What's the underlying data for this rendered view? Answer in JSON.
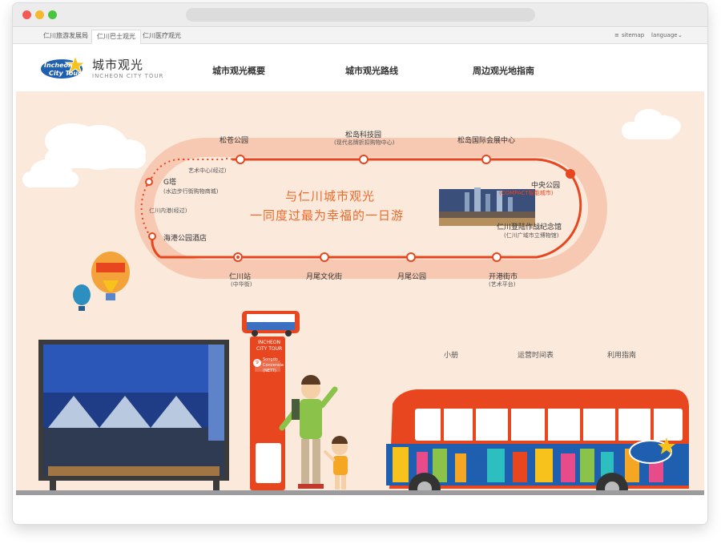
{
  "tabs": [
    "仁川旅游发展局",
    "仁川巴士观光",
    "仁川医疗观光"
  ],
  "util": {
    "sitemap": "sitemap",
    "language": "language"
  },
  "brand": {
    "title": "城市观光",
    "subtitle": "INCHEON CITY TOUR",
    "logo_text_1": "Incheon",
    "logo_text_2": "City Tour"
  },
  "nav": [
    "城市观光概要",
    "城市观光路线",
    "周边观光地指南"
  ],
  "route": {
    "top": [
      "松苍公园",
      "松岛科技园",
      "松岛国际会展中心"
    ],
    "top_sub": "(现代名牌折扣购物中心)",
    "right_1": "中央公园",
    "right_1_sub": "(COMPACT智能城市)",
    "right_2": "仁川登陆作战纪念馆",
    "right_2_sub": "(仁川广域市立博物馆)",
    "bottom": [
      "开港街市",
      "月尾公园",
      "月尾文化街",
      "仁川站"
    ],
    "bottom_sub_1": "(艺术平台)",
    "bottom_sub_2": "(中华街)",
    "left_g": "G塔",
    "left_g_sub": "(水边步行街购物商城)",
    "left_art": "艺术中心(经过)",
    "left_port": "仁川内港(经过)",
    "left_hotel": "海港公园酒店"
  },
  "slogan": {
    "line1": "与仁川城市观光",
    "line2": "一同度过最为幸福的一日游"
  },
  "sign": {
    "top1": "INCHEON",
    "top2": "CITY TOUR",
    "stop_no": "9",
    "stop_a": "Songdo",
    "stop_b": "Convensia",
    "stop_c": "(NETT)"
  },
  "links": [
    "小册",
    "运营时间表",
    "利用指南"
  ],
  "colors": {
    "accent": "#e8461e",
    "route": "#e8461e",
    "hero_bg": "#fbe9dc",
    "slogan": "#ef6a2b"
  }
}
